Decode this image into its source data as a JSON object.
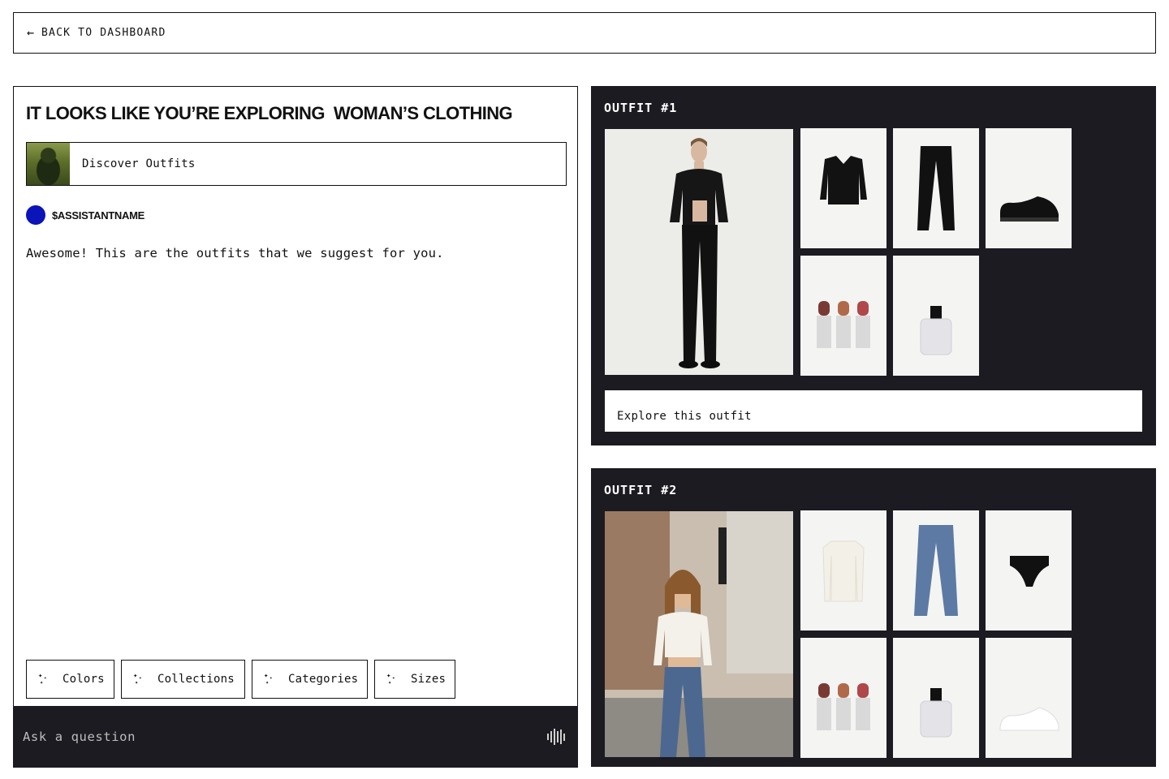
{
  "nav": {
    "back_label": "BACK TO DASHBOARD",
    "back_icon": "arrow-left-icon"
  },
  "chat": {
    "title": "IT LOOKS LIKE YOU’RE EXPLORING  WOMAN’S CLOTHING",
    "discover_label": "Discover Outfits",
    "assistant_name": "$ASSISTANTNAME",
    "assistant_color": "#0a14b8",
    "message": "Awesome! This are the outfits that we suggest for you.",
    "chips": [
      {
        "label": "Colors",
        "icon": "sparkles-icon"
      },
      {
        "label": "Collections",
        "icon": "sparkles-icon"
      },
      {
        "label": "Categories",
        "icon": "sparkles-icon"
      },
      {
        "label": "Sizes",
        "icon": "sparkles-icon"
      }
    ],
    "input_placeholder": "Ask a question",
    "voice_icon": "voice-waveform-icon"
  },
  "outfits": [
    {
      "title": "OUTFIT #1",
      "items": [
        "model-black-suit",
        "black-cropped-blazer",
        "black-trousers",
        "black-loafers",
        "lipsticks",
        "perfume-bottle"
      ],
      "explore_label": "Explore this outfit"
    },
    {
      "title": "OUTFIT #2",
      "items": [
        "model-street",
        "white-cardigan",
        "blue-jeans",
        "black-briefs",
        "lipsticks",
        "perfume-bottle",
        "white-sneakers"
      ]
    }
  ],
  "colors": {
    "panel_dark": "#1c1b21",
    "accent": "#0a14b8"
  }
}
